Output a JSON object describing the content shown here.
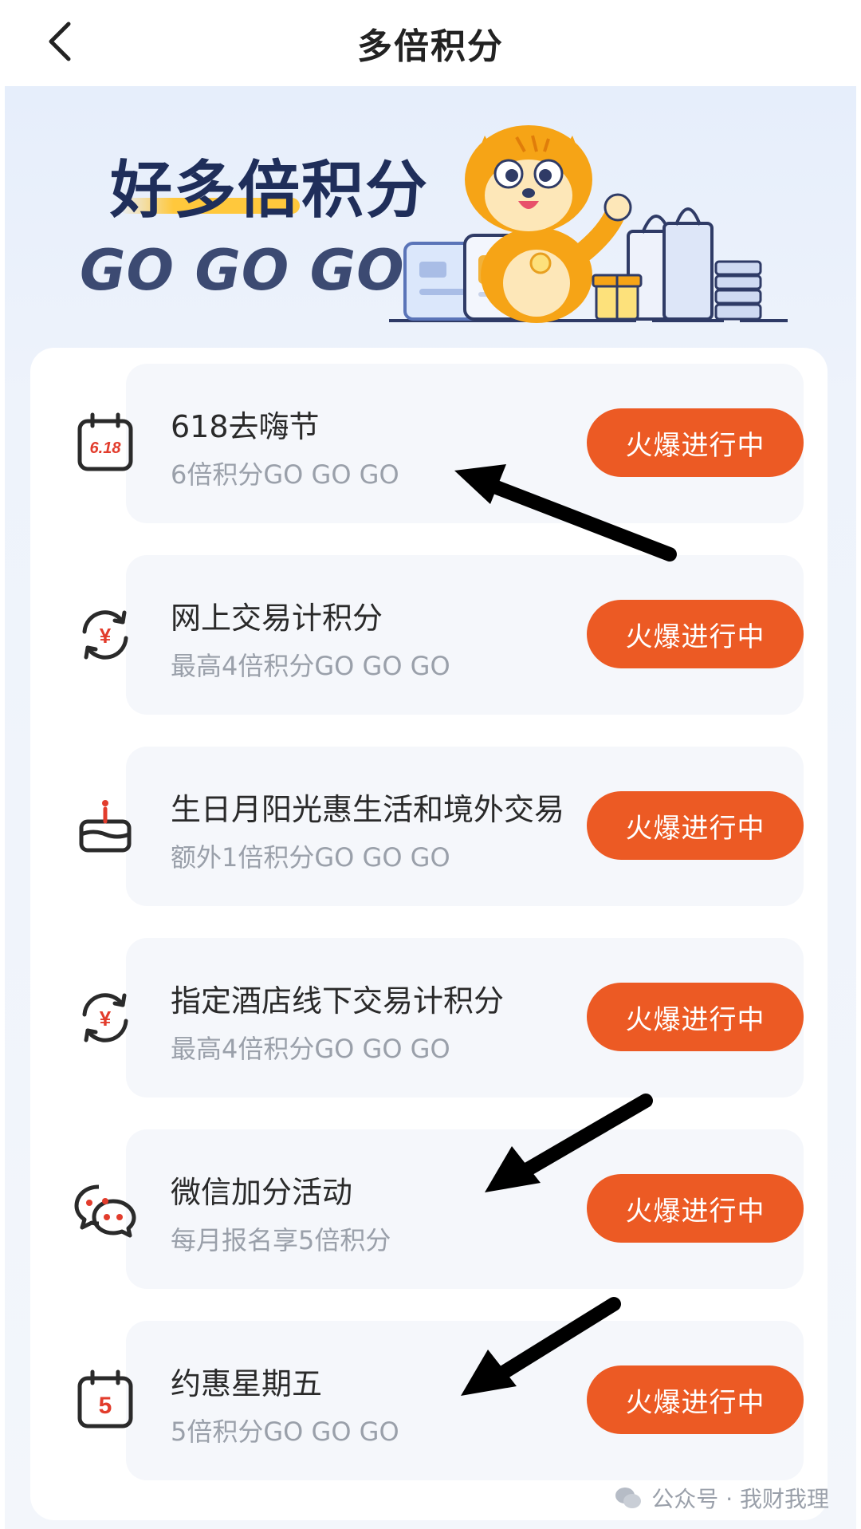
{
  "nav": {
    "title": "多倍积分"
  },
  "hero": {
    "title": "好多倍积分",
    "subtitle": "GO GO GO"
  },
  "activities": [
    {
      "title": "618去嗨节",
      "subtitle": "6倍积分GO GO GO",
      "status": "火爆进行中",
      "icon": "calendar-618-icon"
    },
    {
      "title": "网上交易计积分",
      "subtitle": "最高4倍积分GO GO GO",
      "status": "火爆进行中",
      "icon": "yuan-cycle-icon"
    },
    {
      "title": "生日月阳光惠生活和境外交易",
      "subtitle": "额外1倍积分GO GO GO",
      "status": "火爆进行中",
      "icon": "birthday-cake-icon"
    },
    {
      "title": "指定酒店线下交易计积分",
      "subtitle": "最高4倍积分GO GO GO",
      "status": "火爆进行中",
      "icon": "yuan-cycle-icon"
    },
    {
      "title": "微信加分活动",
      "subtitle": "每月报名享5倍积分",
      "status": "火爆进行中",
      "icon": "wechat-chat-icon"
    },
    {
      "title": "约惠星期五",
      "subtitle": "5倍积分GO GO GO",
      "status": "火爆进行中",
      "icon": "calendar-5-icon"
    }
  ],
  "icon_texts": {
    "calendar_618": "6.18",
    "calendar_5": "5",
    "yuan": "¥"
  },
  "watermark": {
    "text": "公众号 · 我财我理"
  },
  "colors": {
    "accent": "#ec5a24",
    "title_navy": "#1f2e5a",
    "highlight": "#ffc83c",
    "card_bg": "#f5f7fb"
  }
}
